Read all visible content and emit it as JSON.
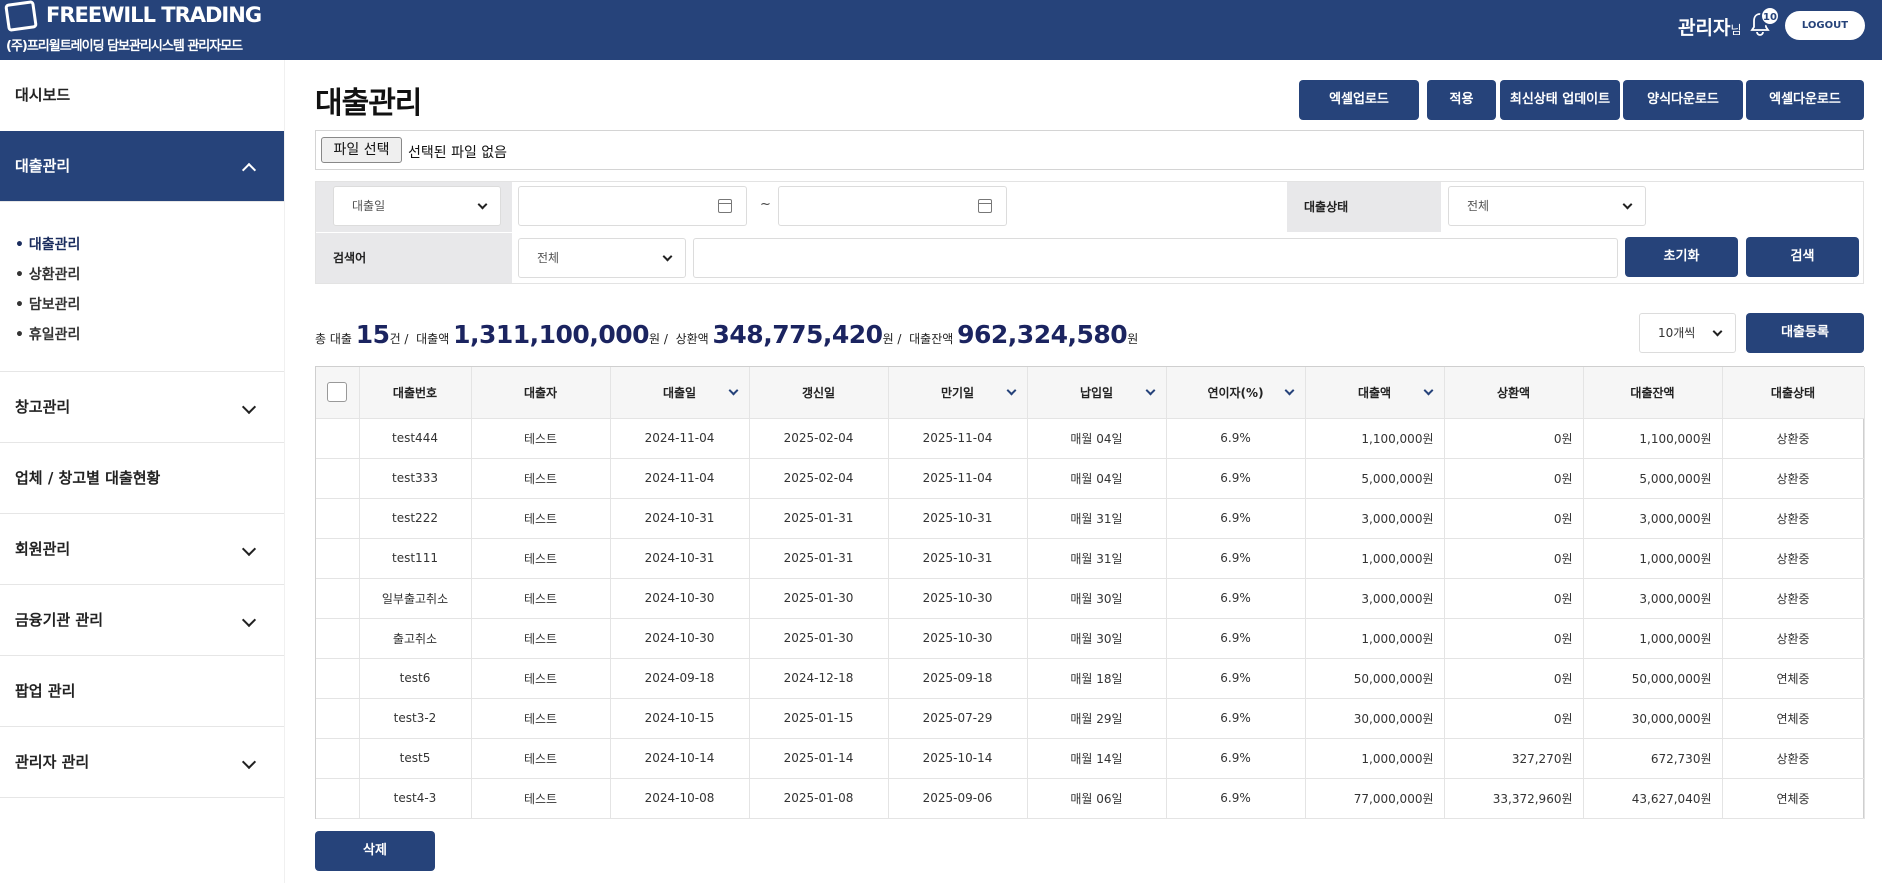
{
  "header": {
    "logo_text": "FREEWILL TRADING",
    "subtitle": "(주)프리윌트레이딩 담보관리시스템 관리자모드",
    "admin_name": "관리자",
    "admin_suffix": "님",
    "notification_count": "10",
    "logout_label": "LOGOUT"
  },
  "sidebar": {
    "dashboard": "대시보드",
    "loan_mgmt": "대출관리",
    "sub_items": [
      "대출관리",
      "상환관리",
      "담보관리",
      "휴일관리"
    ],
    "warehouse": "창고관리",
    "company_status": "업체 / 창고별 대출현황",
    "members": "회원관리",
    "finance": "금융기관 관리",
    "popup": "팝업 관리",
    "admin": "관리자 관리"
  },
  "main": {
    "title": "대출관리",
    "buttons": [
      "엑셀업로드",
      "적용",
      "최신상태 업데이트",
      "양식다운로드",
      "엑셀다운로드"
    ],
    "file_button": "파일 선택",
    "file_status": "선택된 파일 없음"
  },
  "filter": {
    "date_type": "대출일",
    "tilde": "~",
    "status_label": "대출상태",
    "status_value": "전체",
    "keyword_label": "검색어",
    "keyword_type": "전체",
    "reset_label": "초기화",
    "search_label": "검색"
  },
  "summary": {
    "total_prefix": "총 대출",
    "total_count": "15",
    "total_unit": "건 /",
    "loan_label": "대출액",
    "loan_amount": "1,311,100,000",
    "loan_unit": "원 /",
    "repay_label": "상환액",
    "repay_amount": "348,775,420",
    "repay_unit": "원 /",
    "balance_label": "대출잔액",
    "balance_amount": "962,324,580",
    "balance_unit": "원"
  },
  "page_size": "10개씩",
  "register_label": "대출등록",
  "delete_label": "삭제",
  "table": {
    "headers": [
      "대출번호",
      "대출자",
      "대출일",
      "갱신일",
      "만기일",
      "납입일",
      "연이자(%)",
      "대출액",
      "상환액",
      "대출잔액",
      "대출상태"
    ],
    "rows": [
      [
        "test444",
        "테스트",
        "2024-11-04",
        "2025-02-04",
        "2025-11-04",
        "매월 04일",
        "6.9%",
        "1,100,000원",
        "0원",
        "1,100,000원",
        "상환중"
      ],
      [
        "test333",
        "테스트",
        "2024-11-04",
        "2025-02-04",
        "2025-11-04",
        "매월 04일",
        "6.9%",
        "5,000,000원",
        "0원",
        "5,000,000원",
        "상환중"
      ],
      [
        "test222",
        "테스트",
        "2024-10-31",
        "2025-01-31",
        "2025-10-31",
        "매월 31일",
        "6.9%",
        "3,000,000원",
        "0원",
        "3,000,000원",
        "상환중"
      ],
      [
        "test111",
        "테스트",
        "2024-10-31",
        "2025-01-31",
        "2025-10-31",
        "매월 31일",
        "6.9%",
        "1,000,000원",
        "0원",
        "1,000,000원",
        "상환중"
      ],
      [
        "일부출고취소",
        "테스트",
        "2024-10-30",
        "2025-01-30",
        "2025-10-30",
        "매월 30일",
        "6.9%",
        "3,000,000원",
        "0원",
        "3,000,000원",
        "상환중"
      ],
      [
        "출고취소",
        "테스트",
        "2024-10-30",
        "2025-01-30",
        "2025-10-30",
        "매월 30일",
        "6.9%",
        "1,000,000원",
        "0원",
        "1,000,000원",
        "상환중"
      ],
      [
        "test6",
        "테스트",
        "2024-09-18",
        "2024-12-18",
        "2025-09-18",
        "매월 18일",
        "6.9%",
        "50,000,000원",
        "0원",
        "50,000,000원",
        "연체중"
      ],
      [
        "test3-2",
        "테스트",
        "2024-10-15",
        "2025-01-15",
        "2025-07-29",
        "매월 29일",
        "6.9%",
        "30,000,000원",
        "0원",
        "30,000,000원",
        "연체중"
      ],
      [
        "test5",
        "테스트",
        "2024-10-14",
        "2025-01-14",
        "2025-10-14",
        "매월 14일",
        "6.9%",
        "1,000,000원",
        "327,270원",
        "672,730원",
        "상환중"
      ],
      [
        "test4-3",
        "테스트",
        "2024-10-08",
        "2025-01-08",
        "2025-09-06",
        "매월 06일",
        "6.9%",
        "77,000,000원",
        "33,372,960원",
        "43,627,040원",
        "연체중"
      ]
    ]
  }
}
